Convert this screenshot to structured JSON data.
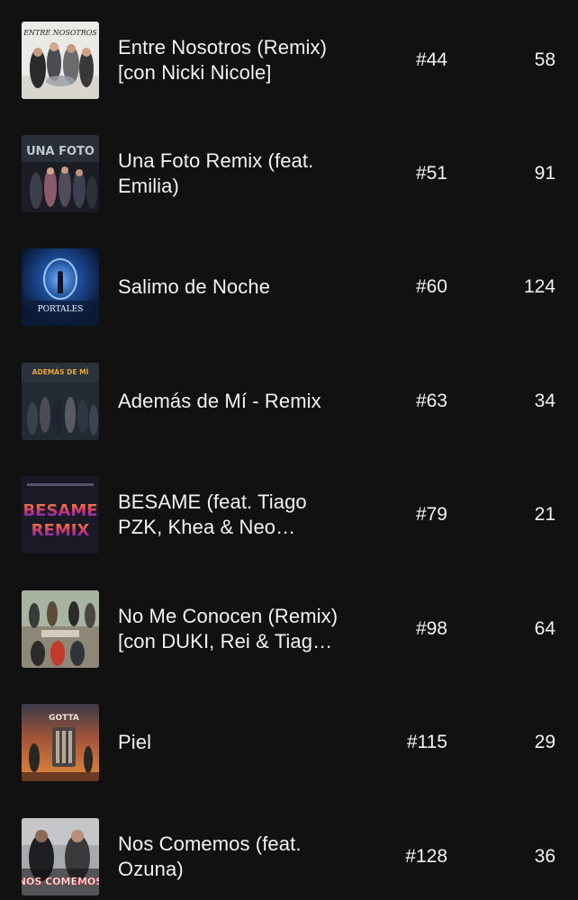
{
  "tracks": [
    {
      "title": "Entre Nosotros (Remix) [con Nicki Nicole]",
      "rank": "#44",
      "count": "58",
      "cover_art": "cover-entre-nosotros",
      "cover_text": "ENTRE NOSOTROS"
    },
    {
      "title": "Una Foto Remix (feat. Emilia)",
      "rank": "#51",
      "count": "91",
      "cover_art": "cover-una-foto",
      "cover_text": "UNA FOTO"
    },
    {
      "title": "Salimo de Noche",
      "rank": "#60",
      "count": "124",
      "cover_art": "cover-portales",
      "cover_text": "PORTALES"
    },
    {
      "title": "Además de Mí - Remix",
      "rank": "#63",
      "count": "34",
      "cover_art": "cover-ademas-de-mi",
      "cover_text": "ADEMÁS DE MÍ"
    },
    {
      "title": "BESAME (feat. Tiago PZK, Khea & Neo Pistea)",
      "rank": "#79",
      "count": "21",
      "cover_art": "cover-besame-remix",
      "cover_text": "BESAME REMIX"
    },
    {
      "title": "No Me Conocen (Remix) [con DUKI, Rei & Tiago PZK]",
      "rank": "#98",
      "count": "64",
      "cover_art": "cover-no-me-conocen",
      "cover_text": ""
    },
    {
      "title": "Piel",
      "rank": "#115",
      "count": "29",
      "cover_art": "cover-gotta-piel",
      "cover_text": "GOTTA"
    },
    {
      "title": "Nos Comemos (feat. Ozuna)",
      "rank": "#128",
      "count": "36",
      "cover_art": "cover-nos-comemos",
      "cover_text": "NOS COMEMOS"
    }
  ]
}
